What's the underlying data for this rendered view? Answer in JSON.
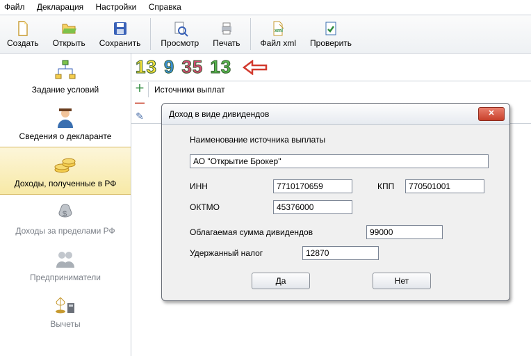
{
  "menu": {
    "file": "Файл",
    "decl": "Декларация",
    "settings": "Настройки",
    "help": "Справка"
  },
  "toolbar": {
    "create": "Создать",
    "open": "Открыть",
    "save": "Сохранить",
    "preview": "Просмотр",
    "print": "Печать",
    "xml": "Файл xml",
    "check": "Проверить"
  },
  "sidebar": {
    "conditions": "Задание условий",
    "declarant": "Сведения о декларанте",
    "income_rf": "Доходы, полученные в РФ",
    "income_abroad": "Доходы за пределами РФ",
    "entrepreneurs": "Предприниматели",
    "deductions": "Вычеты"
  },
  "colored_numbers": [
    "13",
    "9",
    "35",
    "13"
  ],
  "sources_label": "Источники выплат",
  "dialog": {
    "title": "Доход в виде дивидендов",
    "name_label": "Наименование источника выплаты",
    "name_value": "АО \"Открытие Брокер\"",
    "inn_label": "ИНН",
    "inn_value": "7710170659",
    "kpp_label": "КПП",
    "kpp_value": "770501001",
    "oktmo_label": "ОКТМО",
    "oktmo_value": "45376000",
    "taxable_label": "Облагаемая сумма дивидендов",
    "taxable_value": "99000",
    "withheld_label": "Удержанный налог",
    "withheld_value": "12870",
    "yes": "Да",
    "no": "Нет"
  }
}
